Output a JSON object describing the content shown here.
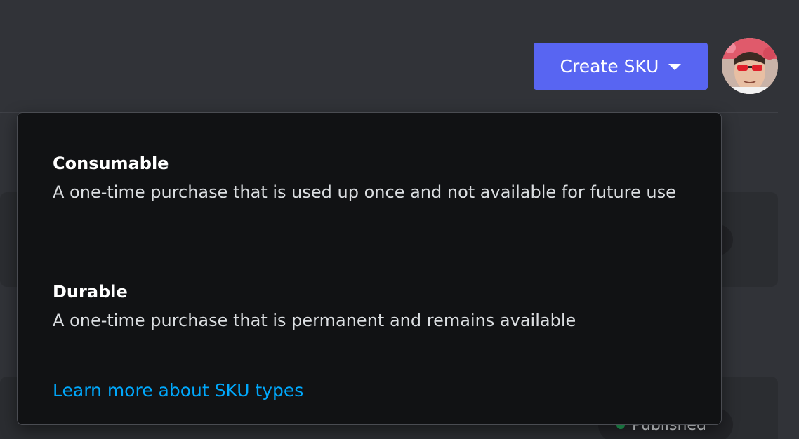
{
  "header": {
    "create_button_label": "Create SKU",
    "create_button_icon": "chevron-down-icon",
    "accent_color": "#5865f2"
  },
  "sku_type_menu": {
    "options": [
      {
        "title": "Consumable",
        "description": "A one-time purchase that is used up once and not available for future use"
      },
      {
        "title": "Durable",
        "description": "A one-time purchase that is permanent and remains available"
      }
    ],
    "learn_more_link": "Learn more about SKU types",
    "link_color": "#00a8fc"
  },
  "background_list": {
    "status_badge": "Published",
    "status_color": "#23a55a"
  }
}
